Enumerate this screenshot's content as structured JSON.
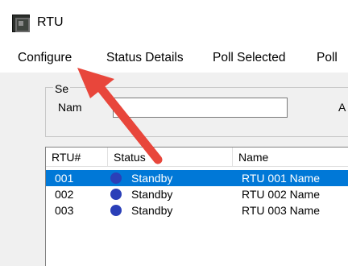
{
  "window": {
    "title": "RTU"
  },
  "menu": [
    "Configure",
    "Status Details",
    "Poll Selected",
    "Poll"
  ],
  "search": {
    "group_label": "Se",
    "name_label": "Nam",
    "name_value": "",
    "a_label": "A"
  },
  "table": {
    "columns": [
      "RTU#",
      "Status",
      "Name"
    ],
    "rows": [
      {
        "id": "001",
        "status": "Standby",
        "name": "RTU 001 Name",
        "selected": true
      },
      {
        "id": "002",
        "status": "Standby",
        "name": "RTU 002 Name",
        "selected": false
      },
      {
        "id": "003",
        "status": "Standby",
        "name": "RTU 003 Name",
        "selected": false
      }
    ]
  },
  "colors": {
    "selection": "#0078d7",
    "status_dot": "#2a3fb8",
    "arrow": "#e8463b"
  },
  "icons": {
    "app": "app-window-icon",
    "status": "status-dot-icon",
    "annotation": "red-arrow-annotation"
  }
}
